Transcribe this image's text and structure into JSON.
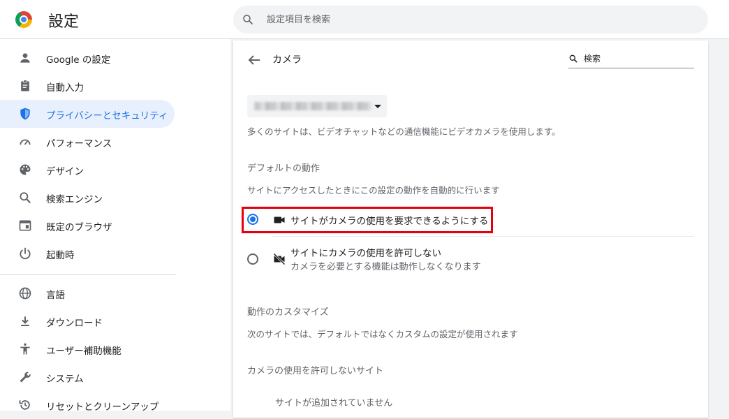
{
  "header": {
    "title": "設定",
    "search_placeholder": "設定項目を検索"
  },
  "sidebar": {
    "items": [
      {
        "label": "Google の設定",
        "icon": "person-icon"
      },
      {
        "label": "自動入力",
        "icon": "clipboard-icon"
      },
      {
        "label": "プライバシーとセキュリティ",
        "icon": "shield-icon",
        "active": true
      },
      {
        "label": "パフォーマンス",
        "icon": "speedometer-icon"
      },
      {
        "label": "デザイン",
        "icon": "palette-icon"
      },
      {
        "label": "検索エンジン",
        "icon": "search-icon"
      },
      {
        "label": "既定のブラウザ",
        "icon": "browser-window-icon"
      },
      {
        "label": "起動時",
        "icon": "power-icon"
      },
      {
        "label": "言語",
        "icon": "globe-icon"
      },
      {
        "label": "ダウンロード",
        "icon": "download-icon"
      },
      {
        "label": "ユーザー補助機能",
        "icon": "accessibility-icon"
      },
      {
        "label": "システム",
        "icon": "wrench-icon"
      },
      {
        "label": "リセットとクリーンアップ",
        "icon": "reset-icon"
      }
    ]
  },
  "main": {
    "page_title": "カメラ",
    "search_placeholder": "検索",
    "description": "多くのサイトは、ビデオチャットなどの通信機能にビデオカメラを使用します。",
    "default_behavior": {
      "heading": "デフォルトの動作",
      "description": "サイトにアクセスしたときにこの設定の動作を自動的に行います",
      "options": [
        {
          "label": "サイトがカメラの使用を要求できるようにする",
          "selected": true,
          "icon": "camera-icon"
        },
        {
          "label": "サイトにカメラの使用を許可しない",
          "sublabel": "カメラを必要とする機能は動作しなくなります",
          "selected": false,
          "icon": "camera-off-icon"
        }
      ]
    },
    "customize": {
      "heading": "動作のカスタマイズ",
      "description": "次のサイトでは、デフォルトではなくカスタムの設定が使用されます"
    },
    "blocked_sites": {
      "heading": "カメラの使用を許可しないサイト",
      "empty_text": "サイトが追加されていません"
    }
  },
  "colors": {
    "accent": "#1a73e8",
    "active_nav_bg": "#e8f0fe",
    "highlight": "#e5000b"
  }
}
